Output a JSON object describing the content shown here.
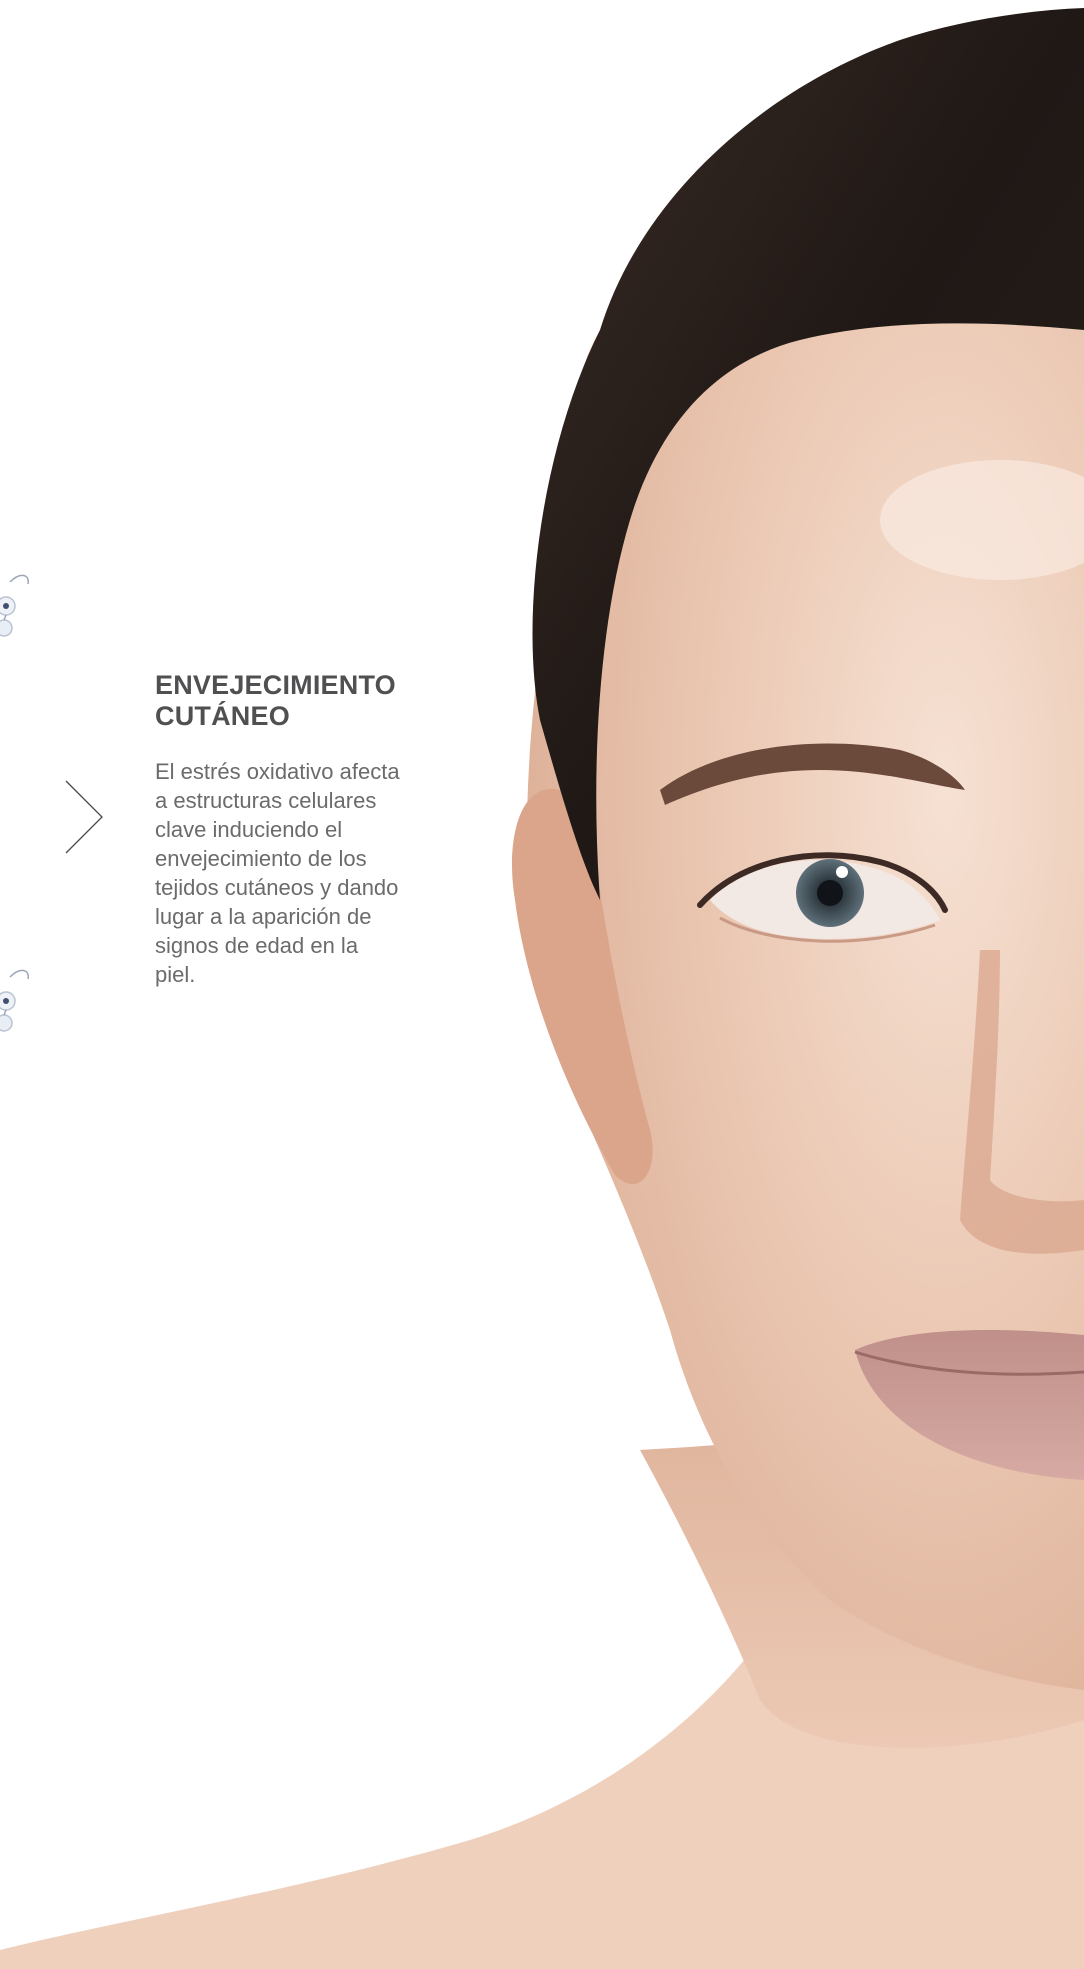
{
  "article": {
    "heading_line1": "ENVEJECIMIENTO",
    "heading_line2": "CUTÁNEO",
    "body_lines": [
      "El estrés oxidativo afecta",
      "a estructuras celulares",
      "clave induciendo el",
      "envejecimiento de los",
      "tejidos cutáneos y dando",
      "lugar a la aparición de",
      "signos de edad en la",
      "piel."
    ]
  },
  "decorations": {
    "arrow_icon": "chevron-right-icon",
    "molecule_icon": "molecule-icon",
    "colors": {
      "heading": "#505052",
      "body": "#6b6b6d",
      "background": "#ffffff",
      "skin": "#e7c2ac",
      "hair": "#2b211d",
      "iris": "#55646e",
      "lips": "#c89a93"
    }
  }
}
